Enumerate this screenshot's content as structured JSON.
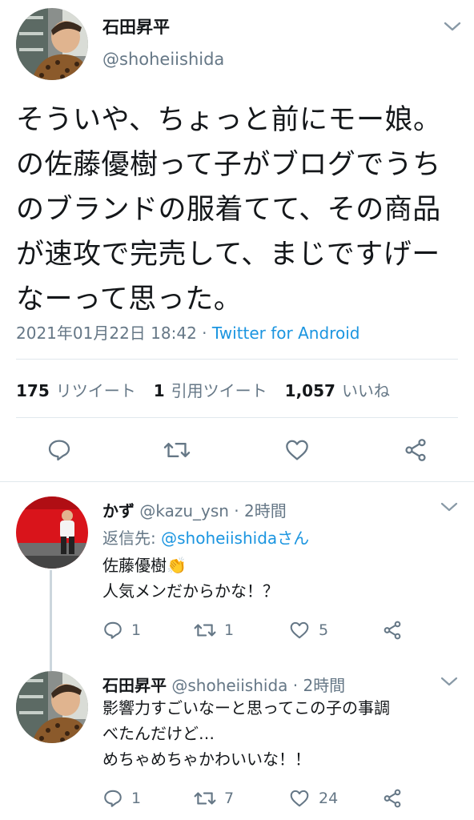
{
  "main_tweet": {
    "display_name": "石田昇平",
    "handle": "@shoheiishida",
    "text_lines": [
      "そういや、ちょっと前にモー娘。",
      "の佐藤優樹って子がブログでうち",
      "のブランドの服着てて、その商品",
      "が速攻で完売して、まじですげー",
      "なーって思った。"
    ],
    "timestamp": "2021年01月22日 18:42",
    "separator": " · ",
    "via": "Twitter for Android",
    "stats": {
      "retweets_count": "175",
      "retweets_label": "リツイート",
      "quotes_count": "1",
      "quotes_label": "引用ツイート",
      "likes_count": "1,057",
      "likes_label": "いいね"
    },
    "icons": [
      "reply-icon",
      "retweet-icon",
      "like-icon",
      "share-icon"
    ]
  },
  "replies": [
    {
      "display_name": "かず",
      "handle": "@kazu_ysn",
      "time": " · 2時間",
      "reply_prefix": "返信先: ",
      "reply_to": "@shoheiishidaさん",
      "text_lines": [
        "佐藤優樹👏",
        "人気メンだからかな！？"
      ],
      "reply_count": "1",
      "retweet_count": "1",
      "like_count": "5"
    },
    {
      "display_name": "石田昇平",
      "handle": "@shoheiishida",
      "time": " · 2時間",
      "text_lines": [
        "影響力すごいなーと思ってこの子の事調",
        "べたんだけど…",
        "めちゃめちゃかわいいな！！"
      ],
      "reply_count": "1",
      "retweet_count": "7",
      "like_count": "24"
    }
  ],
  "colors": {
    "text": "#14171a",
    "secondary": "#657786",
    "link": "#1b95e0",
    "divider": "#e1e8ed"
  }
}
